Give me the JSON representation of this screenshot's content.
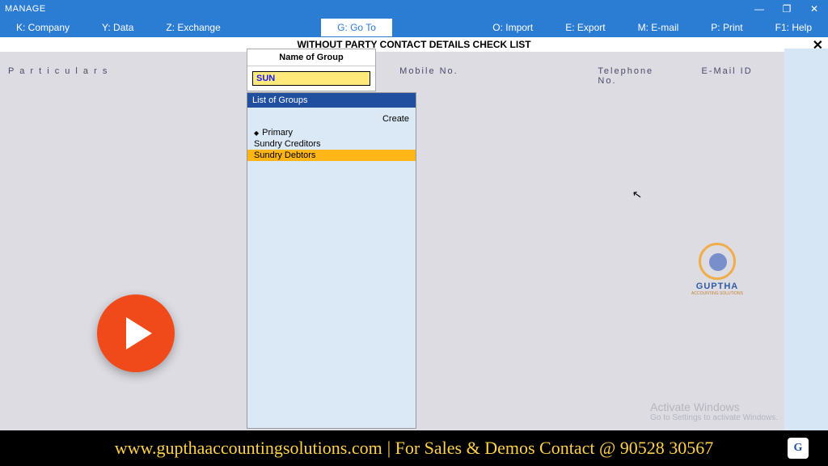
{
  "window": {
    "title": "MANAGE"
  },
  "menu": {
    "k": "K: Company",
    "y": "Y: Data",
    "z": "Z: Exchange",
    "g": "G: Go To",
    "o": "O: Import",
    "e": "E: Export",
    "m": "M: E-mail",
    "p": "P: Print",
    "f1": "F1: Help"
  },
  "report": {
    "title": "WITHOUT PARTY CONTACT DETAILS CHECK LIST"
  },
  "columns": {
    "particulars": "P a r t i c u l a r s",
    "mobile": "Mobile No.",
    "telephone": "Telephone No.",
    "email": "E-Mail ID"
  },
  "group_dialog": {
    "header": "Name of Group",
    "input_value": "SUN"
  },
  "list_panel": {
    "title": "List of Groups",
    "create": "Create",
    "items": [
      {
        "label": "Primary",
        "primary": true,
        "selected": false
      },
      {
        "label": "Sundry Creditors",
        "primary": false,
        "selected": false
      },
      {
        "label": "Sundry Debtors",
        "primary": false,
        "selected": true
      }
    ]
  },
  "logo": {
    "text": "GUPTHA",
    "sub": "ACCOUNTING SOLUTIONS"
  },
  "activate": {
    "l1": "Activate Windows",
    "l2": "Go to Settings to activate Windows."
  },
  "banner": {
    "url": "www.gupthaaccountingsolutions.com",
    "rest": " | For Sales & Demos Contact @ 90528 30567"
  }
}
